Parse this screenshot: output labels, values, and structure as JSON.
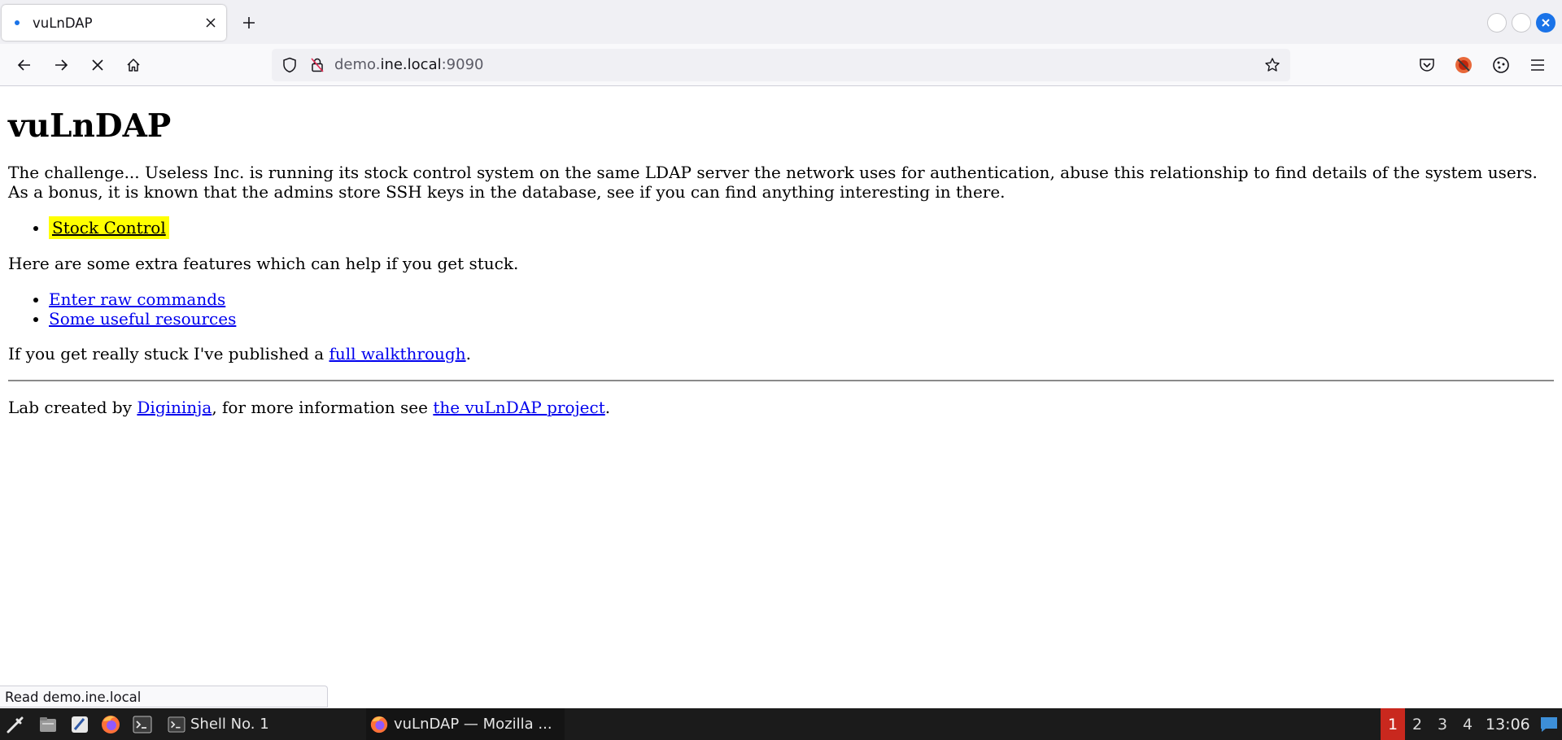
{
  "browser": {
    "tab": {
      "title": "vuLnDAP"
    },
    "url": {
      "prefix": "demo.",
      "host": "ine.local",
      "suffix": ":9090"
    }
  },
  "page": {
    "heading": "vuLnDAP",
    "intro": "The challenge... Useless Inc. is running its stock control system on the same LDAP server the network uses for authentication, abuse this relationship to find details of the system users. As a bonus, it is known that the admins store SSH keys in the database, see if you can find anything interesting in there.",
    "primary_links": [
      "Stock Control"
    ],
    "extras_text": "Here are some extra features which can help if you get stuck.",
    "extra_links": [
      "Enter raw commands",
      "Some useful resources"
    ],
    "walkthrough": {
      "before": "If you get really stuck I've published a ",
      "link": "full walkthrough",
      "after": "."
    },
    "footer": {
      "before": "Lab created by ",
      "author_link": "Digininja",
      "middle": ", for more information see ",
      "project_link": "the vuLnDAP project",
      "after": "."
    }
  },
  "status_bar": "Read demo.ine.local",
  "taskbar": {
    "tasks": [
      "Shell No. 1",
      "vuLnDAP — Mozilla ..."
    ],
    "workspaces": [
      "1",
      "2",
      "3",
      "4"
    ],
    "current_workspace": "1",
    "clock": "13:06"
  },
  "colors": {
    "highlight": "#ffff00",
    "link": "#0000ee",
    "workspace_active": "#c9281e",
    "accent": "#1a73e8"
  }
}
